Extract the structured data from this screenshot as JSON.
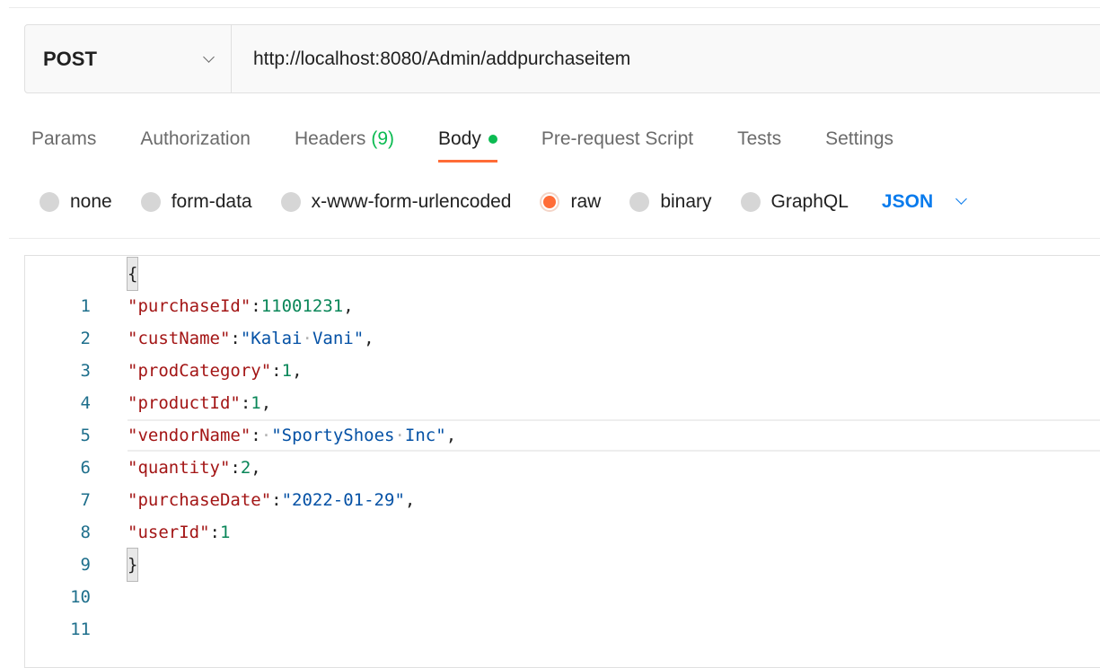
{
  "request": {
    "method": "POST",
    "url": "http://localhost:8080/Admin/addpurchaseitem"
  },
  "tabs": [
    {
      "label": "Params"
    },
    {
      "label": "Authorization"
    },
    {
      "label": "Headers",
      "count": "(9)"
    },
    {
      "label": "Body",
      "active": true
    },
    {
      "label": "Pre-request Script"
    },
    {
      "label": "Tests"
    },
    {
      "label": "Settings"
    }
  ],
  "body_types": [
    {
      "label": "none"
    },
    {
      "label": "form-data"
    },
    {
      "label": "x-www-form-urlencoded"
    },
    {
      "label": "raw",
      "selected": true
    },
    {
      "label": "binary"
    },
    {
      "label": "GraphQL"
    }
  ],
  "format": "JSON",
  "editor": {
    "lines": [
      {
        "num": "1"
      },
      {
        "num": "2",
        "key": "\"purchaseId\"",
        "sep": ":",
        "value": "11001231",
        "value_type": "num",
        "trail": ","
      },
      {
        "num": "3",
        "key": "\"custName\"",
        "sep": ":",
        "value": "\"Kalai·Vani\"",
        "value_type": "str",
        "trail": ","
      },
      {
        "num": "4",
        "key": "\"prodCategory\"",
        "sep": ":",
        "value": "1",
        "value_type": "num",
        "trail": ","
      },
      {
        "num": "5",
        "key": "\"productId\"",
        "sep": ":",
        "value": "1",
        "value_type": "num",
        "trail": ","
      },
      {
        "num": "6",
        "key": "\"vendorName\"",
        "sep": ":·",
        "value": "\"SportyShoes·Inc\"",
        "value_type": "str",
        "trail": ","
      },
      {
        "num": "7",
        "key": "\"quantity\"",
        "sep": ":",
        "value": "2",
        "value_type": "num",
        "trail": ","
      },
      {
        "num": "8",
        "key": "\"purchaseDate\"",
        "sep": ":",
        "value": "\"2022-01-29\"",
        "value_type": "str",
        "trail": ","
      },
      {
        "num": "9",
        "key": "\"userId\"",
        "sep": ":",
        "value": "1",
        "value_type": "num",
        "trail": ""
      },
      {
        "num": "10"
      },
      {
        "num": "11"
      }
    ],
    "open_brace": "{",
    "close_brace": "}"
  },
  "colors": {
    "accent": "#ff6c37",
    "green_indicator": "#0cbb52",
    "link_blue": "#097bed"
  }
}
